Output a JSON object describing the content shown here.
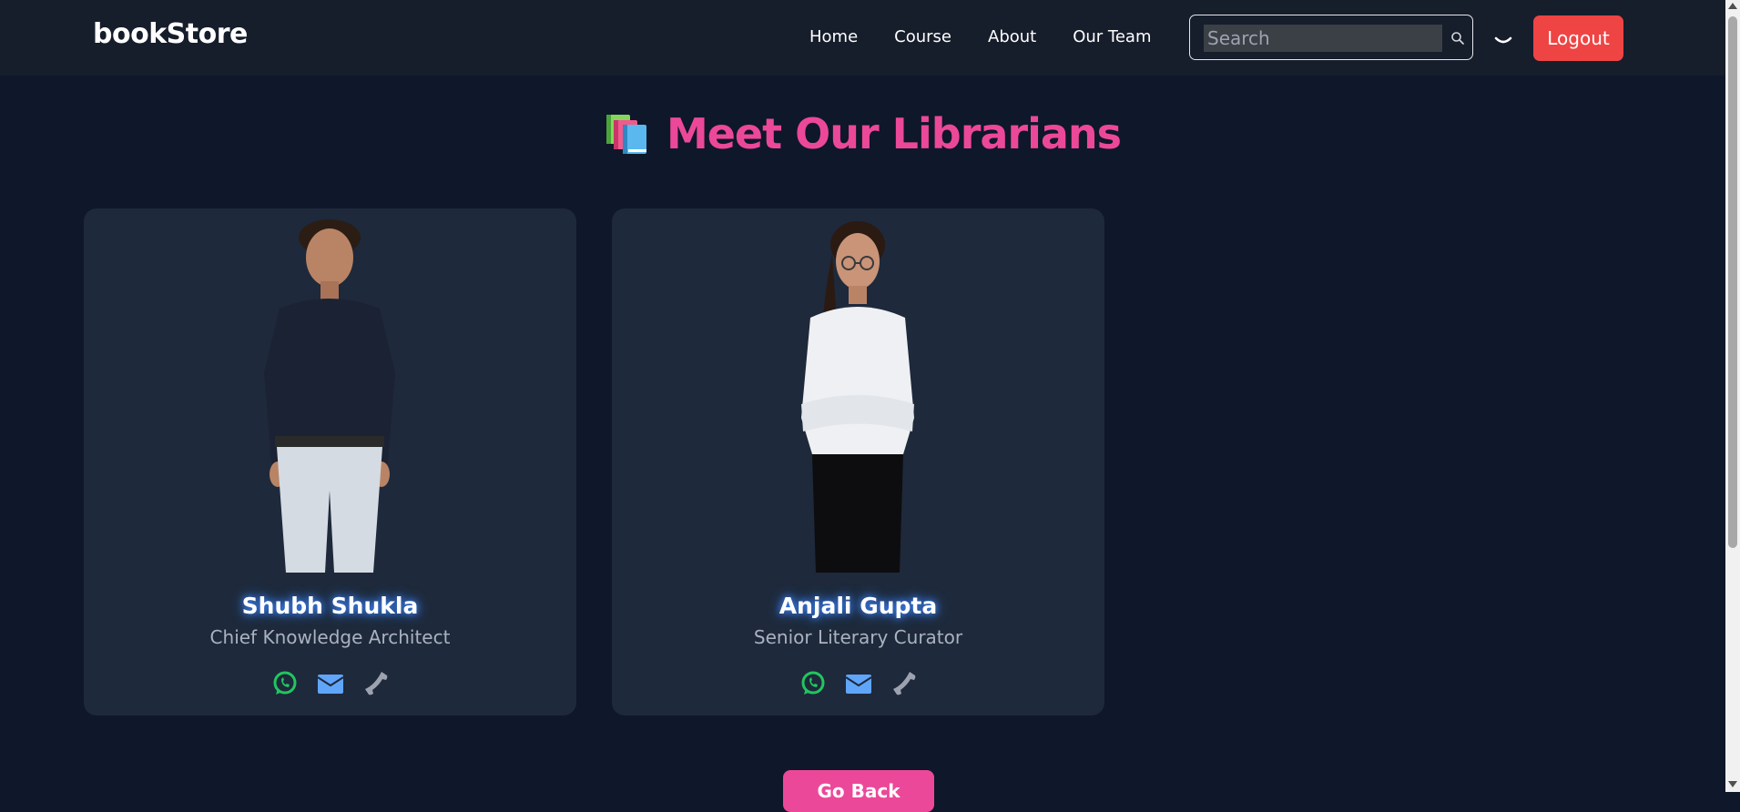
{
  "nav": {
    "brand": "bookStore",
    "links": [
      "Home",
      "Course",
      "About",
      "Our Team"
    ],
    "search_placeholder": "Search",
    "logout_label": "Logout"
  },
  "page": {
    "title": "Meet Our Librarians",
    "go_back_label": "Go Back"
  },
  "members": [
    {
      "name": "Shubh Shukla",
      "role": "Chief Knowledge Architect",
      "contacts": [
        "whatsapp-icon",
        "mail-icon",
        "phone-icon"
      ]
    },
    {
      "name": "Anjali Gupta",
      "role": "Senior Literary Curator",
      "contacts": [
        "whatsapp-icon",
        "mail-icon",
        "phone-icon"
      ]
    }
  ],
  "colors": {
    "background": "#0f172a",
    "navbar": "#161d2b",
    "card": "#1e293b",
    "accent_pink": "#ec4899",
    "logout_red": "#ef4444",
    "whatsapp_green": "#22c55e",
    "mail_blue": "#60a5fa",
    "phone_gray": "#9ca3af"
  }
}
